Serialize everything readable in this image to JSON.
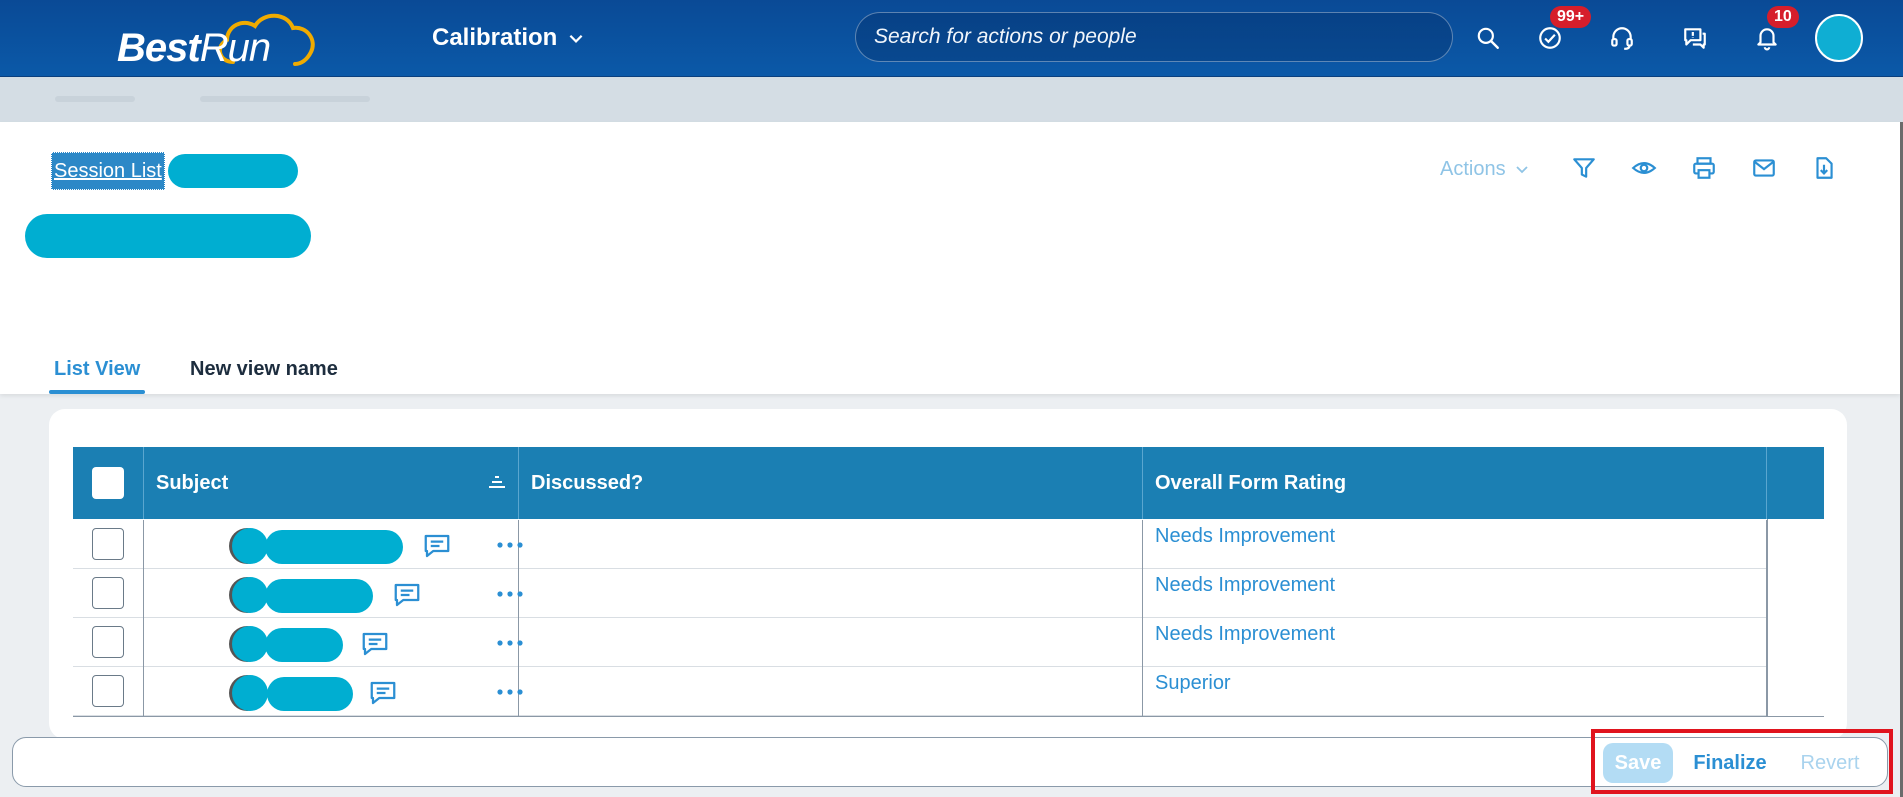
{
  "shell": {
    "logo_bold": "Best",
    "logo_rest": "Run",
    "app_title": "Calibration",
    "search_placeholder": "Search for actions or people",
    "todo_badge": "99+",
    "notifications_badge": "10"
  },
  "header": {
    "breadcrumb_link": "Session List",
    "actions_label": "Actions"
  },
  "tabs": [
    {
      "label": "List View"
    },
    {
      "label": "New view name"
    }
  ],
  "table": {
    "columns": [
      "Subject",
      "Discussed?",
      "Overall Form Rating"
    ],
    "rows": [
      {
        "rating": "Needs Improvement"
      },
      {
        "rating": "Needs Improvement"
      },
      {
        "rating": "Needs Improvement"
      },
      {
        "rating": "Superior"
      }
    ]
  },
  "footer": {
    "save": "Save",
    "finalize": "Finalize",
    "revert": "Revert"
  },
  "colors": {
    "shell": "#0a4a96",
    "accent": "#2b8fd3",
    "table_header": "#1b7fb3",
    "redaction": "#00aed1",
    "highlight": "#e0141e"
  }
}
